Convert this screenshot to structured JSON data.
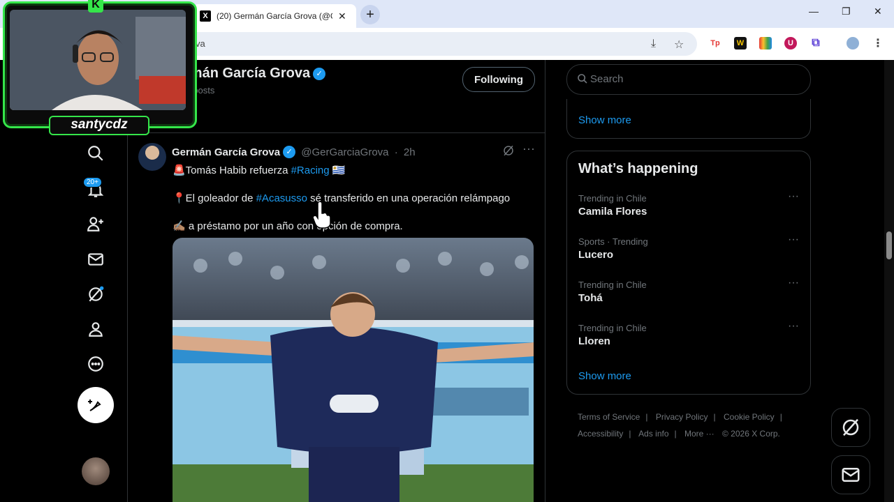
{
  "browser": {
    "tab_title": "(20) Germán García Grova (@G",
    "tab_favicon": "X",
    "address_text": "va",
    "icons": [
      "install-icon",
      "star-icon",
      "extension-icon",
      "profile-icon",
      "menu-icon"
    ]
  },
  "nav": {
    "notifications_badge": "20+",
    "icons": [
      "search-icon",
      "notifications-icon",
      "follow-icon",
      "messages-icon",
      "grok-icon",
      "profile-icon",
      "more-icon",
      "compose-icon"
    ]
  },
  "profile": {
    "name": "rmán García Grova",
    "posts": "K posts",
    "follow_label": "Following"
  },
  "tweet": {
    "name": "Germán García Grova",
    "handle": "@GerGarciaGrova",
    "dot": "·",
    "time": "2h",
    "line1_a": "🚨Tomás Habib refuerza ",
    "line1_hash": "#Racing",
    "line1_b": " 🇺🇾",
    "line2_a": "📍El goleador de ",
    "line2_hash": "#Acasusso",
    "line2_b": " sé transferido en una operación relámpago",
    "line3": "✍🏽 a préstamo por un año con opción de compra."
  },
  "sidebar": {
    "search_placeholder": "Search",
    "show_more_1": "Show more",
    "happening_title": "What’s happening",
    "trends": [
      {
        "meta": "Trending in Chile",
        "name": "Camila Flores"
      },
      {
        "meta": "Sports · Trending",
        "name": "Lucero"
      },
      {
        "meta": "Trending in Chile",
        "name": "Tohá"
      },
      {
        "meta": "Trending in Chile",
        "name": "Lloren"
      }
    ],
    "show_more_2": "Show more",
    "footer": {
      "terms": "Terms of Service",
      "privacy": "Privacy Policy",
      "cookie": "Cookie Policy",
      "accessibility": "Accessibility",
      "ads": "Ads info",
      "more": "More ···",
      "copyright": "© 2026 X Corp."
    }
  },
  "webcam": {
    "streamer_name": "santycdz",
    "logo": "K"
  },
  "colors": {
    "accent": "#1d9bf0",
    "background": "#000000",
    "cam_border": "#35e64a"
  }
}
